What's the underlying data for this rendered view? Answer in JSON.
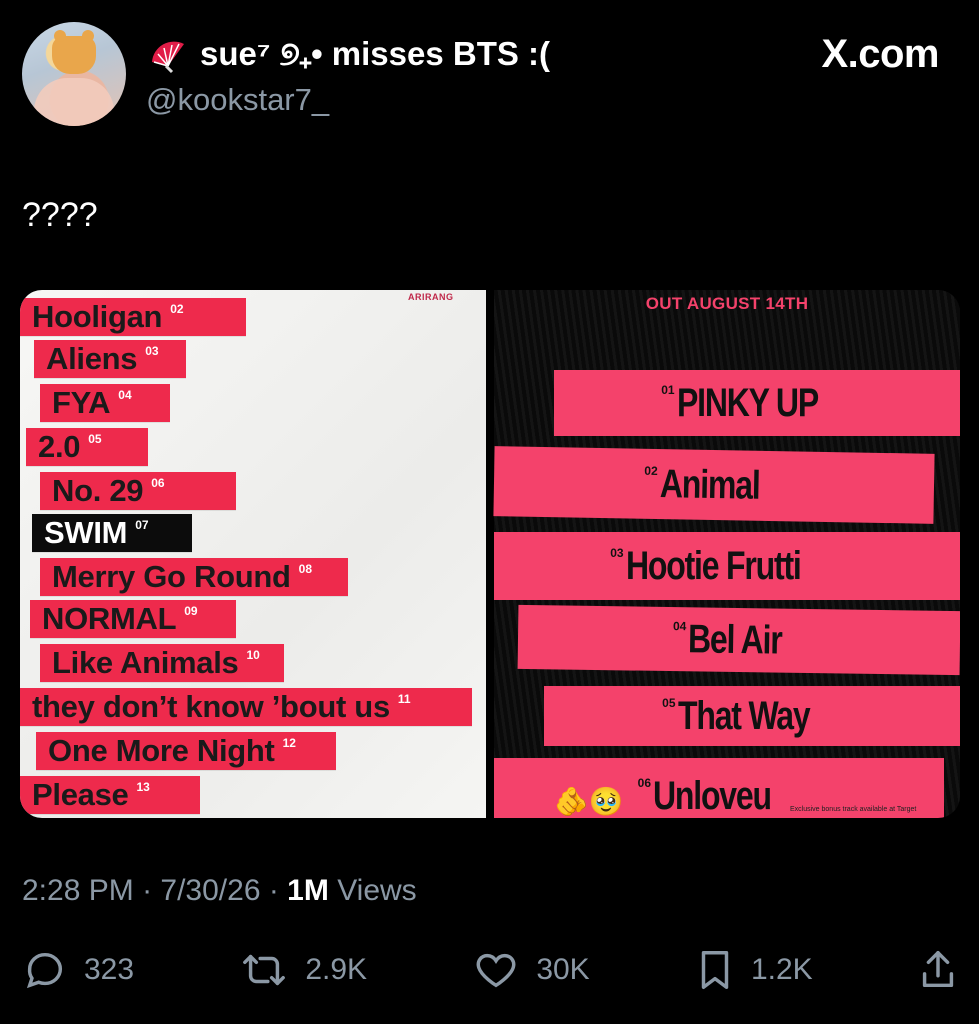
{
  "header": {
    "display_name": "sue⁷ ୭₊• misses BTS :(",
    "handle": "@kookstar7_",
    "source": "X.com",
    "name_icon": "folding-fan-icon",
    "accent_color": "#e11d48"
  },
  "tweet": {
    "text": "????"
  },
  "media_left": {
    "brand": "ARIRANG",
    "tracks": [
      {
        "title": "Hooligan",
        "num": "02"
      },
      {
        "title": "Aliens",
        "num": "03"
      },
      {
        "title": "FYA",
        "num": "04"
      },
      {
        "title": "2.0",
        "num": "05"
      },
      {
        "title": "No. 29",
        "num": "06"
      },
      {
        "title": "SWIM",
        "num": "07"
      },
      {
        "title": "Merry Go Round",
        "num": "08"
      },
      {
        "title": "NORMAL",
        "num": "09"
      },
      {
        "title": "Like Animals",
        "num": "10"
      },
      {
        "title": "they don’t know ’bout us",
        "num": "11"
      },
      {
        "title": "One More Night",
        "num": "12"
      },
      {
        "title": "Please",
        "num": "13"
      }
    ],
    "strip_color": "#ee2a4c",
    "highlight_color": "#0c0c0c"
  },
  "media_right": {
    "release": "OUT AUGUST 14TH",
    "tracks": [
      {
        "num": "01",
        "title": "PINKY UP"
      },
      {
        "num": "02",
        "title": "Animal"
      },
      {
        "num": "03",
        "title": "Hootie Frutti"
      },
      {
        "num": "04",
        "title": "Bel Air"
      },
      {
        "num": "05",
        "title": "That Way"
      },
      {
        "num": "06",
        "title": "Unloveu"
      }
    ],
    "bonus_note": "Exclusive bonus track available at Target",
    "emoji": "🫵🥹",
    "strip_color": "#f4426b"
  },
  "meta": {
    "time": "2:28 PM",
    "date": "7/30/26",
    "views": "1M",
    "views_label": "Views"
  },
  "actions": {
    "replies": "323",
    "reposts": "2.9K",
    "likes": "30K",
    "bookmarks": "1.2K"
  }
}
